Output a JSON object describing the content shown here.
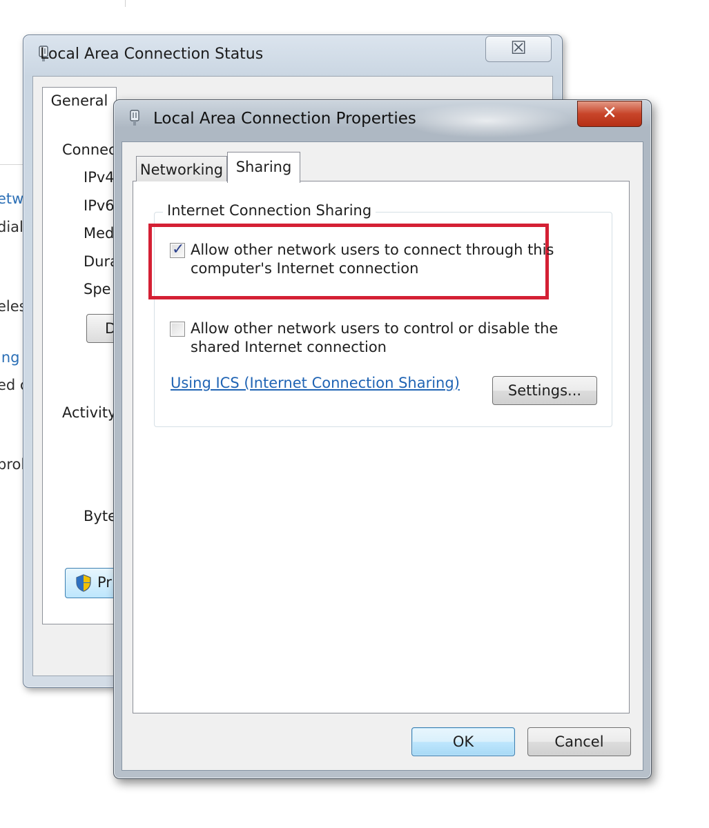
{
  "background_window": {
    "fragments": [
      "etw",
      "dial",
      "eles",
      "ing",
      "ed c",
      "prol"
    ]
  },
  "status_window": {
    "title": "Local Area Connection Status",
    "close_glyph": "☒",
    "tab_general": "General",
    "labels": [
      "Connec",
      "IPv4",
      "IPv6",
      "Med",
      "Dura",
      "Spe",
      "Activity",
      "Byte"
    ],
    "button_fragment": "D",
    "properties_fragment": "Pr"
  },
  "properties_dialog": {
    "title": "Local Area Connection Properties",
    "close_glyph": "✕",
    "tabs": {
      "networking": "Networking",
      "sharing": "Sharing"
    },
    "group_title": "Internet Connection Sharing",
    "allow_connect": {
      "line1": "Allow other network users to connect through this",
      "line2": "computer's Internet connection",
      "checked": true
    },
    "allow_control": {
      "line1": "Allow other network users to control or disable the",
      "line2": "shared Internet connection",
      "checked": false
    },
    "ics_link": "Using ICS (Internet Connection Sharing)",
    "settings_button": "Settings...",
    "ok_button": "OK",
    "cancel_button": "Cancel"
  },
  "colors": {
    "highlight": "#d42034",
    "link": "#2064b4",
    "close_red": "#c8452a"
  },
  "icons": {
    "window": "network-connection-icon",
    "shield": "uac-shield-icon",
    "check": "✓"
  }
}
